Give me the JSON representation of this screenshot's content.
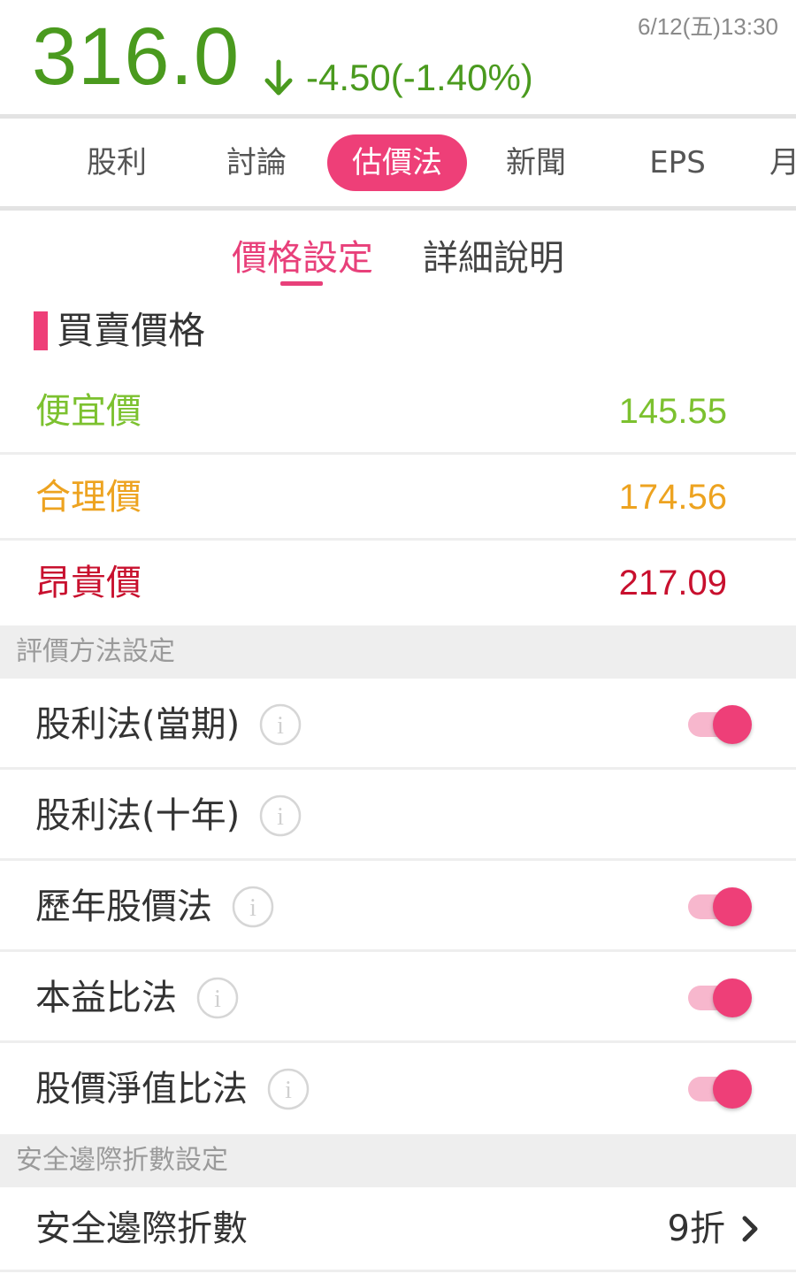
{
  "quote": {
    "price": "316.0",
    "change": "-4.50(-1.40%)",
    "timestamp": "6/12(五)13:30",
    "direction_icon": "arrow-down-icon",
    "color": "#4a9a1e"
  },
  "tabs": [
    {
      "label": "股利"
    },
    {
      "label": "討論"
    },
    {
      "label": "估價法",
      "active": true
    },
    {
      "label": "新聞"
    },
    {
      "label": "EPS"
    },
    {
      "label": "月"
    }
  ],
  "segmented": {
    "active": "價格設定",
    "inactive": "詳細說明"
  },
  "buy_sell": {
    "title": "買賣價格",
    "rows": [
      {
        "label": "便宜價",
        "value": "145.55",
        "color": "#7cc12f"
      },
      {
        "label": "合理價",
        "value": "174.56",
        "color": "#eda320"
      },
      {
        "label": "昂貴價",
        "value": "217.09",
        "color": "#c8102e"
      }
    ]
  },
  "valuation_methods": {
    "header": "評價方法設定",
    "items": [
      {
        "label": "股利法(當期)",
        "enabled": true
      },
      {
        "label": "股利法(十年)",
        "enabled": false
      },
      {
        "label": "歷年股價法",
        "enabled": true
      },
      {
        "label": "本益比法",
        "enabled": true
      },
      {
        "label": "股價淨值比法",
        "enabled": true
      }
    ]
  },
  "safety_margin": {
    "header": "安全邊際折數設定",
    "label": "安全邊際折數",
    "value": "9折"
  },
  "accent_color": "#ee3f78"
}
